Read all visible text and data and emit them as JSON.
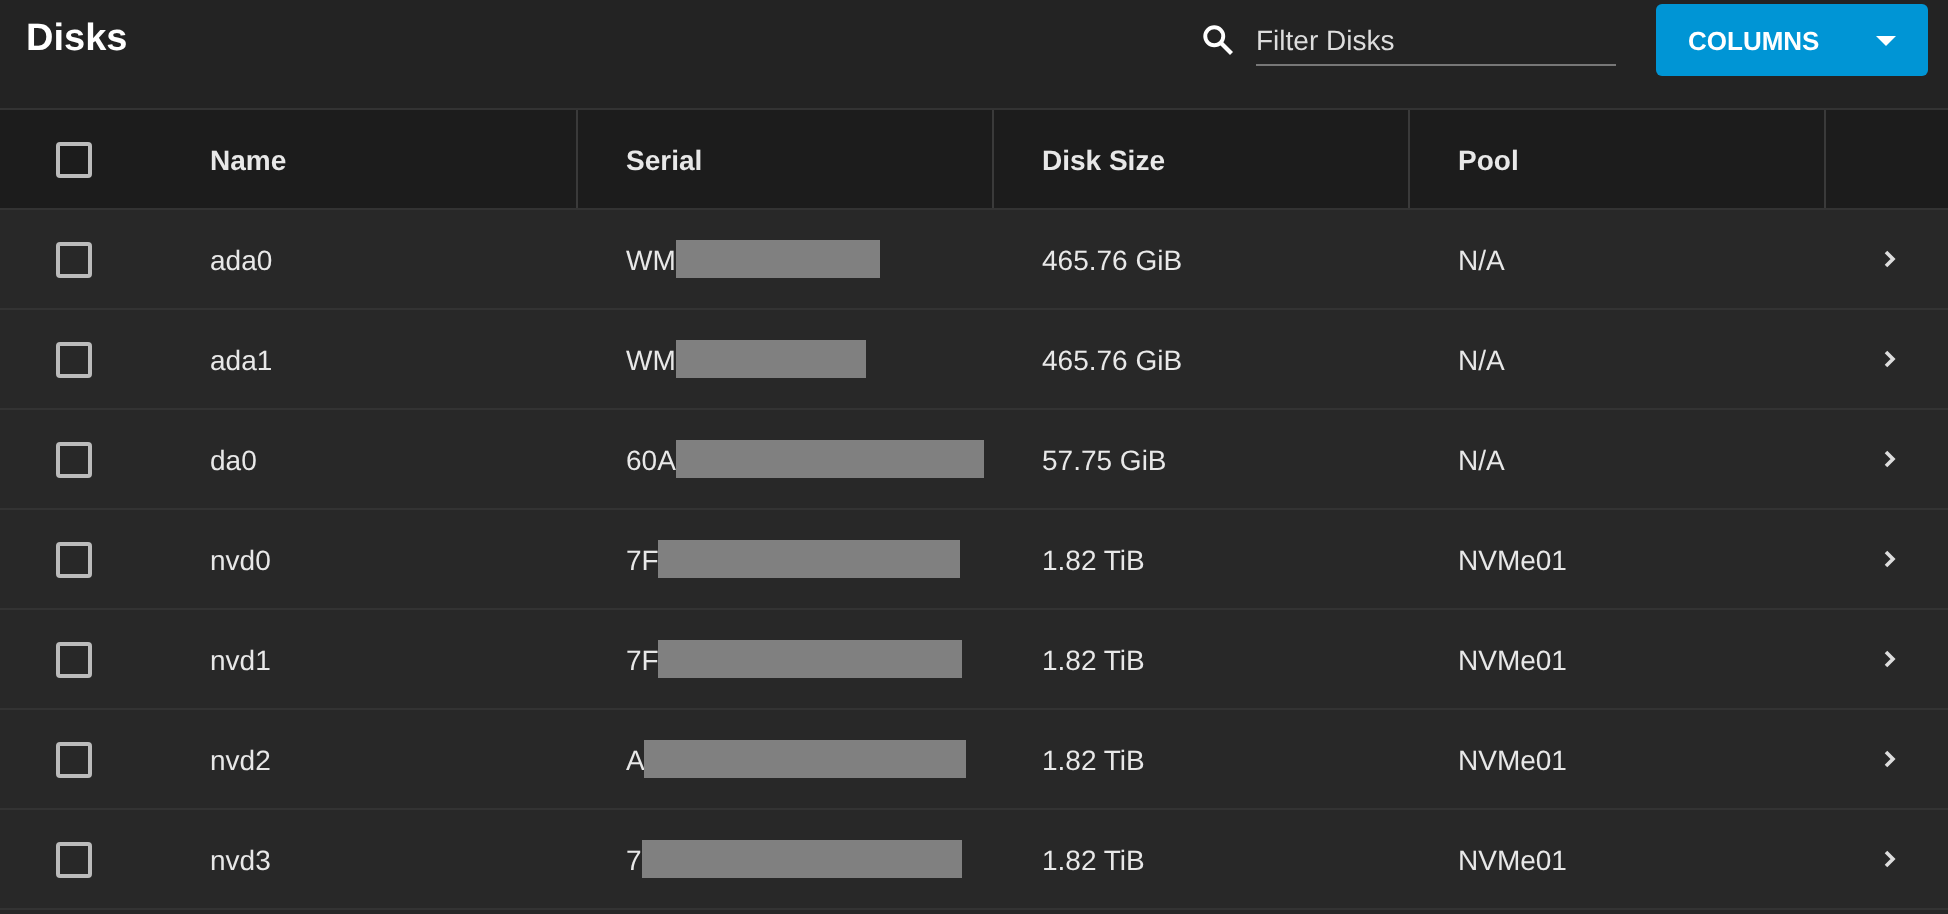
{
  "title": "Disks",
  "filter": {
    "placeholder": "Filter Disks"
  },
  "columns_button": {
    "label": "COLUMNS"
  },
  "table": {
    "select_all": {
      "checked": false
    },
    "columns": [
      "Name",
      "Serial",
      "Disk Size",
      "Pool"
    ],
    "rows": [
      {
        "checked": false,
        "name": "ada0",
        "serial": "WM",
        "size": "465.76 GiB",
        "pool": "N/A"
      },
      {
        "checked": false,
        "name": "ada1",
        "serial": "WM",
        "size": "465.76 GiB",
        "pool": "N/A"
      },
      {
        "checked": false,
        "name": "da0",
        "serial": "60A",
        "size": "57.75 GiB",
        "pool": "N/A"
      },
      {
        "checked": false,
        "name": "nvd0",
        "serial": "7F",
        "size": "1.82 TiB",
        "pool": "NVMe01"
      },
      {
        "checked": false,
        "name": "nvd1",
        "serial": "7F",
        "size": "1.82 TiB",
        "pool": "NVMe01"
      },
      {
        "checked": false,
        "name": "nvd2",
        "serial": "A",
        "size": "1.82 TiB",
        "pool": "NVMe01"
      },
      {
        "checked": false,
        "name": "nvd3",
        "serial": "7",
        "size": "1.82 TiB",
        "pool": "NVMe01"
      }
    ]
  }
}
